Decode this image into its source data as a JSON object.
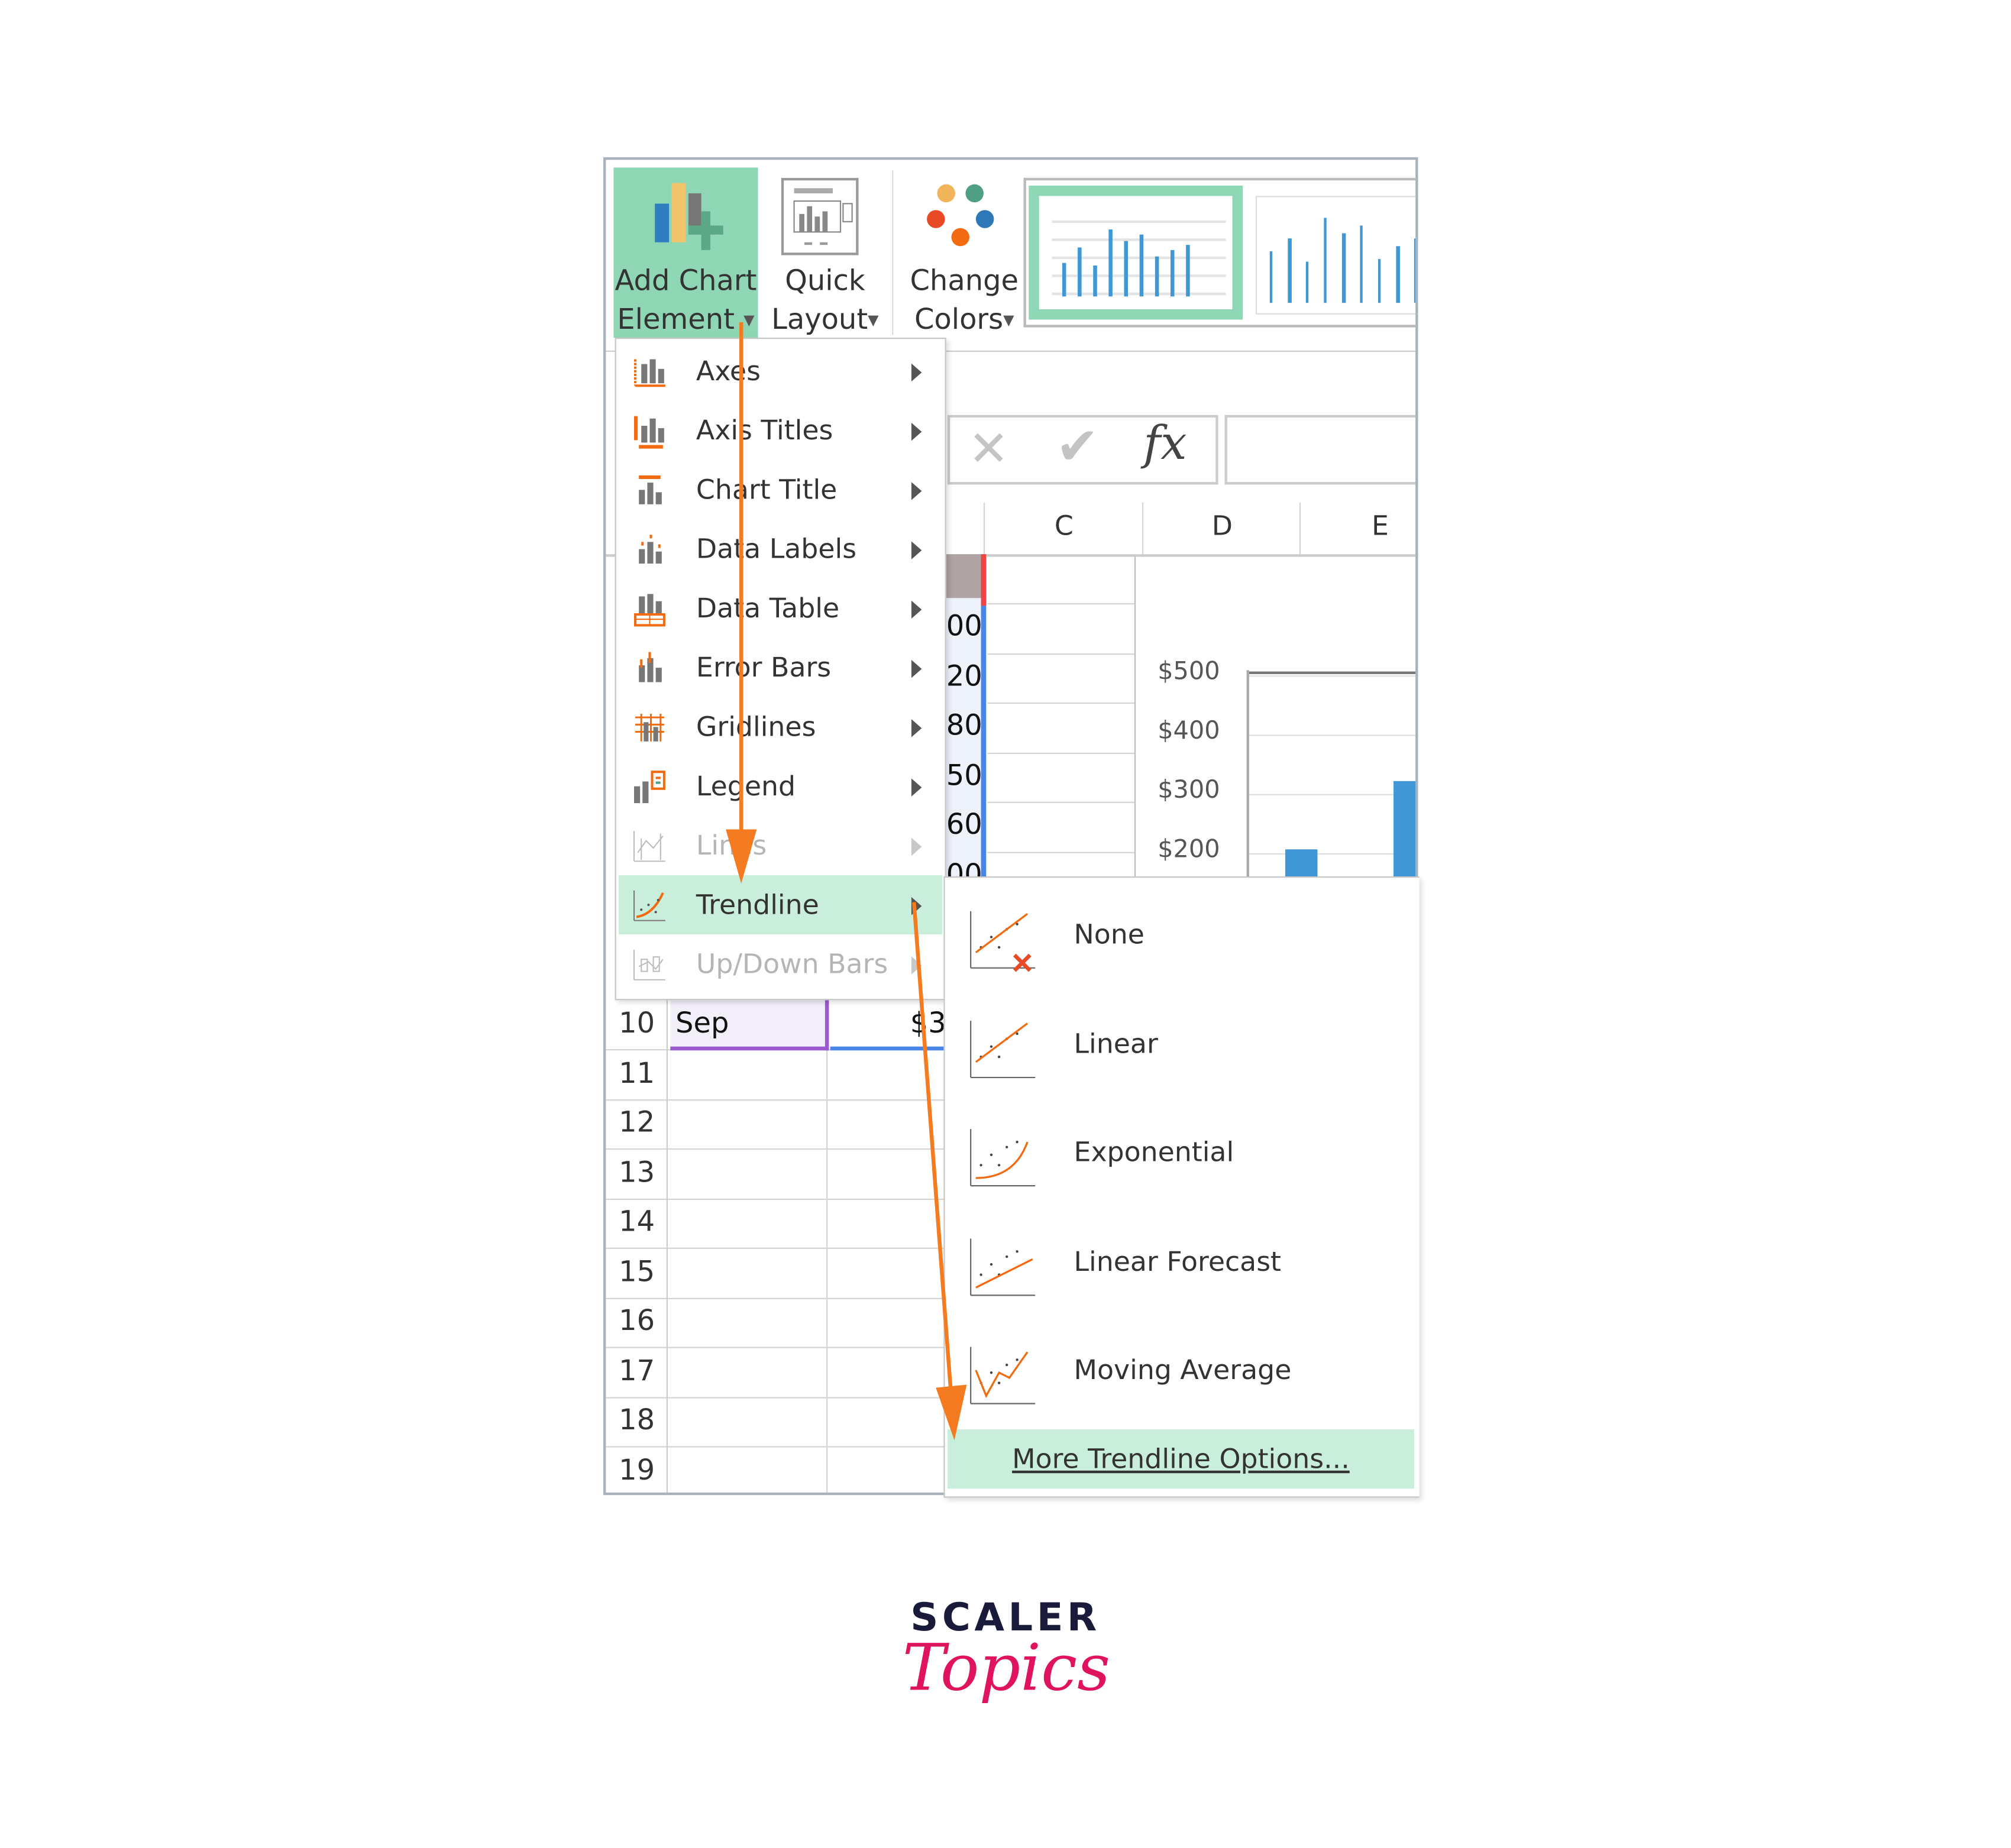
{
  "ribbon": {
    "add_chart_element": {
      "line1": "Add Chart",
      "line2": "Element"
    },
    "quick_layout": {
      "line1": "Quick",
      "line2": "Layout"
    },
    "change_colors": {
      "line1": "Change",
      "line2": "Colors"
    }
  },
  "formula_bar": {
    "cancel_icon": "x-icon",
    "enter_icon": "check-icon",
    "fx_label": "fx",
    "value": ""
  },
  "columns": [
    "C",
    "D",
    "E"
  ],
  "partial_column_values": [
    "00",
    "20",
    "80",
    "50",
    "60",
    "00"
  ],
  "chart": {
    "y_tick_labels": [
      "$500",
      "$400",
      "$300",
      "$200"
    ]
  },
  "rows": {
    "numbers": [
      "10",
      "11",
      "12",
      "13",
      "14",
      "15",
      "16",
      "17",
      "18",
      "19"
    ],
    "row10": {
      "a": "Sep",
      "b": "$3"
    }
  },
  "menu": {
    "items": [
      {
        "label": "Axes",
        "icon": "axes-icon",
        "enabled": true
      },
      {
        "label": "Axis Titles",
        "icon": "axis-titles-icon",
        "enabled": true
      },
      {
        "label": "Chart Title",
        "icon": "chart-title-icon",
        "enabled": true
      },
      {
        "label": "Data Labels",
        "icon": "data-labels-icon",
        "enabled": true
      },
      {
        "label": "Data Table",
        "icon": "data-table-icon",
        "enabled": true
      },
      {
        "label": "Error Bars",
        "icon": "error-bars-icon",
        "enabled": true
      },
      {
        "label": "Gridlines",
        "icon": "gridlines-icon",
        "enabled": true
      },
      {
        "label": "Legend",
        "icon": "legend-icon",
        "enabled": true
      },
      {
        "label": "Lines",
        "icon": "lines-icon",
        "enabled": false
      },
      {
        "label": "Trendline",
        "icon": "trendline-icon",
        "enabled": true,
        "selected": true
      },
      {
        "label": "Up/Down Bars",
        "icon": "updown-bars-icon",
        "enabled": false
      }
    ]
  },
  "submenu": {
    "items": [
      {
        "label": "None",
        "icon": "trendline-none-icon"
      },
      {
        "label": "Linear",
        "icon": "trendline-linear-icon"
      },
      {
        "label": "Exponential",
        "icon": "trendline-exponential-icon"
      },
      {
        "label": "Linear Forecast",
        "icon": "trendline-forecast-icon"
      },
      {
        "label": "Moving Average",
        "icon": "trendline-moving-average-icon"
      }
    ],
    "more_options": "More Trendline Options..."
  },
  "logo": {
    "line1": "SCALER",
    "line2": "Topics"
  },
  "colors": {
    "accent_green": "#8fd6b4",
    "highlight_green": "#c9eedb",
    "arrow_orange": "#f47b20",
    "bar_blue": "#3f97d6",
    "logo_navy": "#1a1a3a",
    "logo_pink": "#e0135f"
  }
}
